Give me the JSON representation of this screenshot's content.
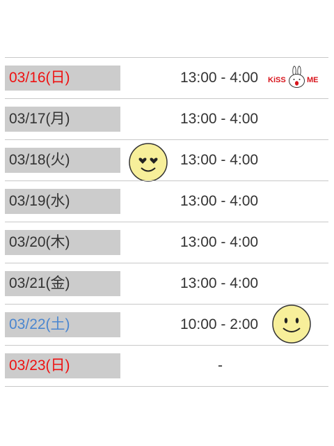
{
  "schedule": {
    "rows": [
      {
        "date": "03/16(日)",
        "time": "13:00 - 4:00",
        "date_color": "red",
        "sticker": "kiss-me-bunny-icon"
      },
      {
        "date": "03/17(月)",
        "time": "13:00 - 4:00",
        "date_color": "default"
      },
      {
        "date": "03/18(火)",
        "time": "13:00 - 4:00",
        "date_color": "default",
        "sticker": "heart-eyes-smiley-icon"
      },
      {
        "date": "03/19(水)",
        "time": "13:00 - 4:00",
        "date_color": "default"
      },
      {
        "date": "03/20(木)",
        "time": "13:00 - 4:00",
        "date_color": "default"
      },
      {
        "date": "03/21(金)",
        "time": "13:00 - 4:00",
        "date_color": "default"
      },
      {
        "date": "03/22(土)",
        "time": "10:00 - 2:00",
        "date_color": "blue",
        "sticker": "smiley-face-icon"
      },
      {
        "date": "03/23(日)",
        "time": "-",
        "date_color": "red"
      }
    ],
    "sticker_text": {
      "kiss": "KiSS",
      "me": "ME"
    }
  },
  "colors": {
    "sunday": "#ee1111",
    "saturday": "#4a86d0",
    "date_bg": "#cccccc",
    "divider": "#c8c8c8",
    "text": "#333333",
    "smiley_fill": "#f7ef9a"
  }
}
